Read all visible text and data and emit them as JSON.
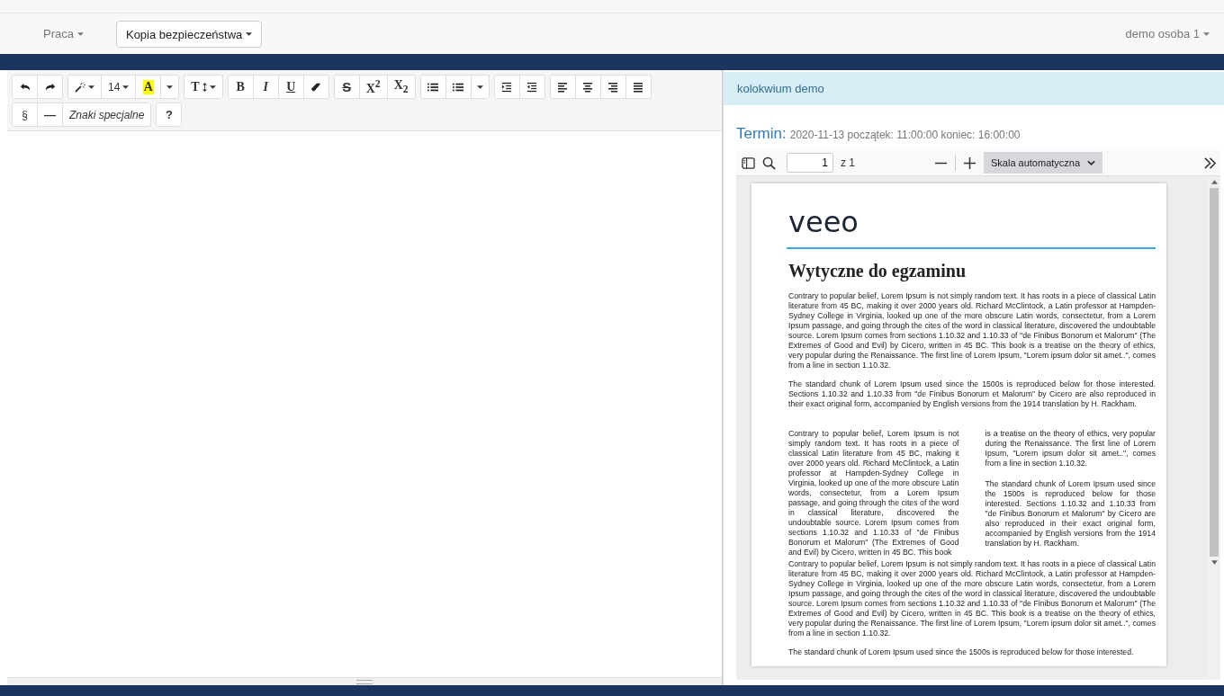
{
  "navbar": {
    "menu": "Praca",
    "backup_button": "Kopia bezpieczeństwa",
    "user_menu": "demo osoba 1"
  },
  "toolbar_rows": [
    [
      [
        {
          "kind": "undo"
        },
        {
          "kind": "redo"
        }
      ],
      [
        {
          "kind": "wand"
        },
        {
          "kind": "size",
          "label": "14"
        },
        {
          "kind": "highlight",
          "label": "A"
        },
        {
          "kind": "caret"
        }
      ],
      [
        {
          "kind": "textsize",
          "label": "T"
        }
      ],
      [
        {
          "kind": "bold",
          "label": "B"
        },
        {
          "kind": "italic",
          "label": "I"
        },
        {
          "kind": "underline",
          "label": "U"
        },
        {
          "kind": "eraser"
        }
      ],
      [
        {
          "kind": "strike",
          "label": "S"
        },
        {
          "kind": "bold",
          "label": "X$^{2}$"
        },
        {
          "kind": "bold",
          "label": "X$_{2}$"
        }
      ],
      [
        {
          "kind": "bullets"
        },
        {
          "kind": "numbers"
        },
        {
          "kind": "caret"
        }
      ],
      [
        {
          "kind": "indent"
        },
        {
          "kind": "outdent"
        }
      ],
      [
        {
          "kind": "align-left"
        },
        {
          "kind": "align-center"
        },
        {
          "kind": "align-right"
        },
        {
          "kind": "justify"
        }
      ]
    ],
    [
      [
        {
          "kind": "plain",
          "label": "§"
        },
        {
          "kind": "strong",
          "label": "—"
        },
        {
          "kind": "italic-label",
          "label": "Znaki specjalne"
        }
      ],
      [
        {
          "kind": "strong",
          "label": "?"
        }
      ]
    ]
  ],
  "exam": {
    "title": "kolokwium demo",
    "term_label": "Termin:",
    "term_text": "2020-11-13 początek: 11:00:00 koniec: 16:00:00"
  },
  "pdf_toolbar": {
    "page": "1",
    "page_count": "z 1",
    "scale": "Skala automatyczna"
  },
  "document": {
    "logo": "veeo",
    "heading": "Wytyczne do egzaminu",
    "paragraphs": [
      "Contrary to popular belief, Lorem Ipsum is not simply random text. It has roots in a piece of classical Latin literature from 45 BC, making it over 2000 years old. Richard McClintock, a Latin professor at Hampden-Sydney College in Virginia, looked up one of the more obscure Latin words, consectetur, from a Lorem Ipsum passage, and going through the cites of the word in classical literature, discovered the undoubtable source. Lorem Ipsum comes from sections 1.10.32 and 1.10.33 of \"de Finibus Bonorum et Malorum\" (The Extremes of Good and Evil) by Cicero, written in 45 BC. This book is a treatise on the theory of ethics, very popular during the Renaissance. The first line of Lorem Ipsum, \"Lorem ipsum dolor sit amet..\", comes from a line in section 1.10.32.",
      "The standard chunk of Lorem Ipsum used since the 1500s is reproduced below for those interested. Sections 1.10.32 and 1.10.33 from \"de Finibus Bonorum et Malorum\" by Cicero are also reproduced in their exact original form, accompanied by English versions from the 1914 translation by H. Rackham."
    ],
    "columns": [
      [
        "Contrary to popular belief, Lorem Ipsum is not simply random text. It has roots in a piece of classical Latin literature from 45 BC, making it over 2000 years old. Richard McClintock, a Latin professor at Hampden-Sydney College in Virginia, looked up one of the more obscure Latin words, consectetur, from a Lorem Ipsum passage, and going through the cites of the word in classical literature, discovered the undoubtable source. Lorem Ipsum comes from sections 1.10.32 and 1.10.33 of \"de Finibus Bonorum et Malorum\" (The Extremes of Good and Evil) by Cicero, written in 45 BC. This book"
      ],
      [
        "is a treatise on the theory of ethics, very popular during the Renaissance. The first line of Lorem Ipsum, \"Lorem ipsum dolor sit amet..\", comes from a line in section 1.10.32.",
        "The standard chunk of Lorem Ipsum used since the 1500s is reproduced below for those interested. Sections 1.10.32 and 1.10.33 from \"de Finibus Bonorum et Malorum\" by Cicero are also reproduced in their exact original form, accompanied by English versions from the 1914 translation by H. Rackham."
      ]
    ],
    "after_columns": [
      "Contrary to popular belief, Lorem Ipsum is not simply random text. It has roots in a piece of classical Latin literature from 45 BC, making it over 2000 years old. Richard McClintock, a Latin professor at Hampden-Sydney College in Virginia, looked up one of the more obscure Latin words, consectetur, from a Lorem Ipsum passage, and going through the cites of the word in classical literature, discovered the undoubtable source. Lorem Ipsum comes from sections 1.10.32 and 1.10.33 of \"de Finibus Bonorum et Malorum\" (The Extremes of Good and Evil) by Cicero, written in 45 BC. This book is a treatise on the theory of ethics, very popular during the Renaissance. The first line of Lorem Ipsum, \"Lorem ipsum dolor sit amet..\", comes from a line in section 1.10.32.",
      "The standard chunk of Lorem Ipsum used since the 1500s is reproduced below for those interested."
    ]
  }
}
